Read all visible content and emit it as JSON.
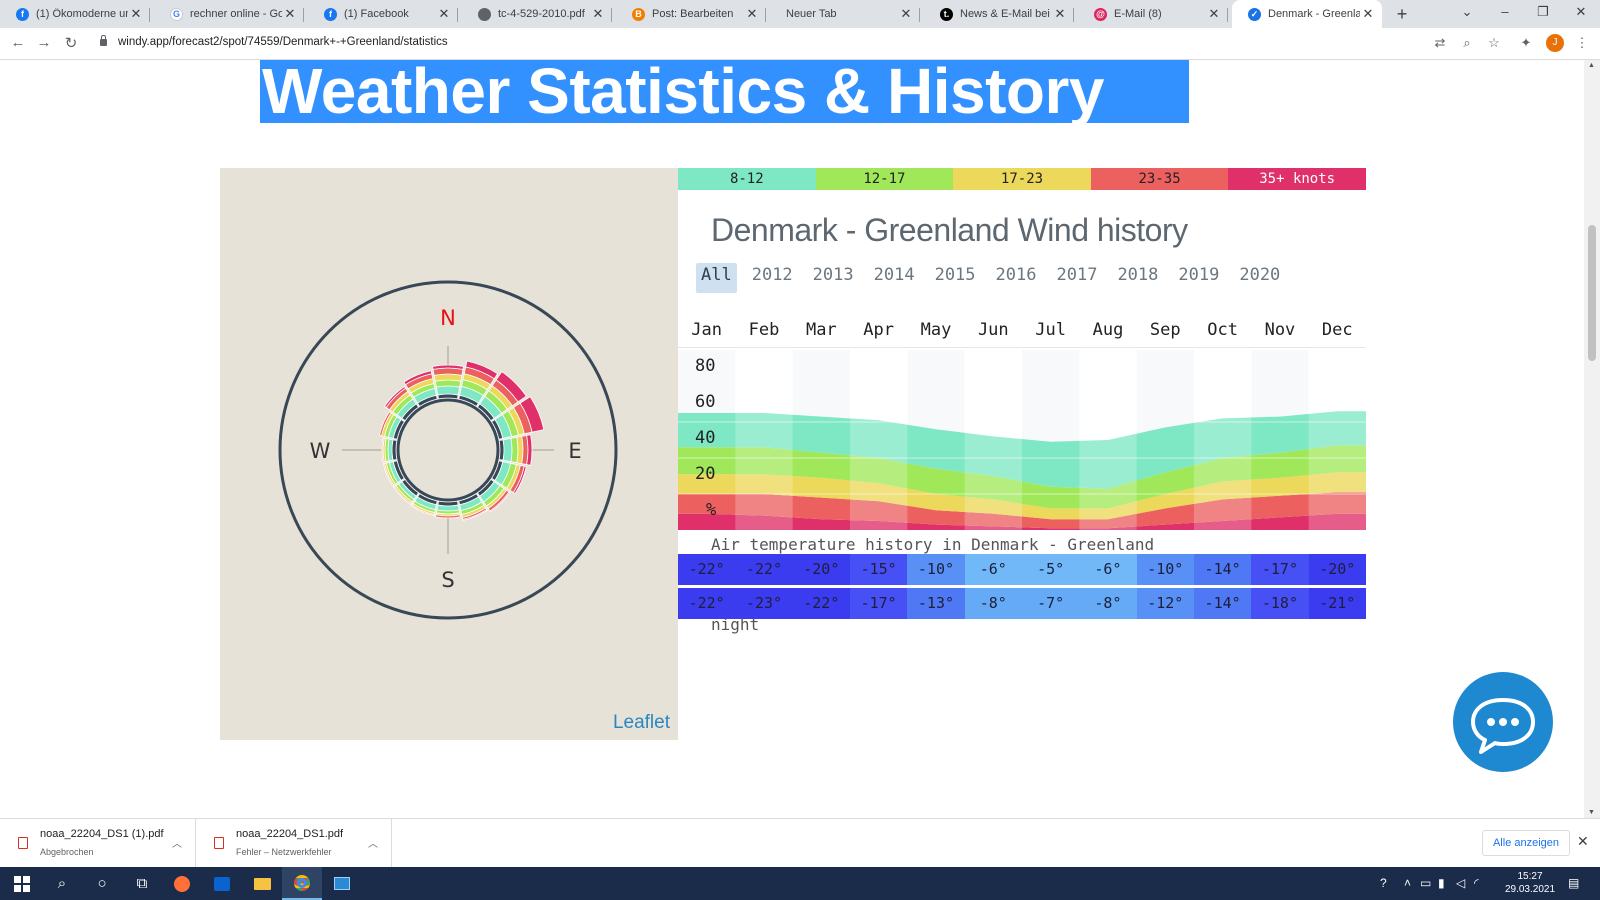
{
  "browser": {
    "tabs": [
      {
        "title": "(1) Ökomoderne und E",
        "favicon": "facebook-icon",
        "color": "#1877f2",
        "glyph": "f"
      },
      {
        "title": "rechner online - Goog",
        "favicon": "google-icon",
        "color": "#ffffff",
        "glyph": "G"
      },
      {
        "title": "(1) Facebook",
        "favicon": "facebook-icon",
        "color": "#1877f2",
        "glyph": "f"
      },
      {
        "title": "tc-4-529-2010.pdf",
        "favicon": "globe-icon",
        "color": "#5f6368",
        "glyph": ""
      },
      {
        "title": "Post: Bearbeiten",
        "favicon": "blogger-icon",
        "color": "#f57d00",
        "glyph": "B"
      },
      {
        "title": "Neuer Tab",
        "favicon": "",
        "color": "",
        "glyph": ""
      },
      {
        "title": "News & E-Mail bei t-o",
        "favicon": "t-online-icon",
        "color": "#000000",
        "glyph": "t."
      },
      {
        "title": "E-Mail (8)",
        "favicon": "at-icon",
        "color": "#e0245e",
        "glyph": "@"
      },
      {
        "title": "Denmark - Greenland",
        "favicon": "windy-icon",
        "color": "#1a73e8",
        "glyph": "✓",
        "active": true
      }
    ],
    "url": "windy.app/forecast2/spot/74559/Denmark+-+Greenland/statistics",
    "profile_initial": "J"
  },
  "page": {
    "hero_title": "Weather Statistics & History",
    "map_attribution": "Leaflet",
    "compass": {
      "n": "N",
      "e": "E",
      "s": "S",
      "w": "W"
    },
    "wind_legend": [
      {
        "label": "8-12",
        "color": "#7ee8c4"
      },
      {
        "label": "12-17",
        "color": "#a0e85a"
      },
      {
        "label": "17-23",
        "color": "#ecd85a"
      },
      {
        "label": "23-35",
        "color": "#ec6060"
      },
      {
        "label": "35+ knots",
        "color": "#e0306a"
      }
    ],
    "wind_title": "Denmark - Greenland Wind history",
    "years": [
      "All",
      "2012",
      "2013",
      "2014",
      "2015",
      "2016",
      "2017",
      "2018",
      "2019",
      "2020"
    ],
    "selected_year": "All",
    "months": [
      "Jan",
      "Feb",
      "Mar",
      "Apr",
      "May",
      "Jun",
      "Jul",
      "Aug",
      "Sep",
      "Oct",
      "Nov",
      "Dec"
    ],
    "temp_title": "Air temperature history in Denmark - Greenland",
    "night_label": "night"
  },
  "chart_data": {
    "type": "area",
    "title": "",
    "categories": [
      "Jan",
      "Feb",
      "Mar",
      "Apr",
      "May",
      "Jun",
      "Jul",
      "Aug",
      "Sep",
      "Oct",
      "Nov",
      "Dec"
    ],
    "ylabel": "%",
    "yticks": [
      "80",
      "60",
      "40",
      "20"
    ],
    "ylim": [
      0,
      80
    ],
    "series": [
      {
        "name": "35+ knots",
        "values": [
          9,
          8,
          6,
          5,
          3,
          2,
          1,
          1,
          3,
          5,
          7,
          9
        ]
      },
      {
        "name": "23-35",
        "values": [
          11,
          12,
          12,
          11,
          8,
          7,
          5,
          5,
          9,
          12,
          12,
          12
        ]
      },
      {
        "name": "17-23",
        "values": [
          11,
          11,
          11,
          10,
          9,
          8,
          6,
          6,
          8,
          10,
          10,
          11
        ]
      },
      {
        "name": "12-17",
        "values": [
          15,
          15,
          14,
          14,
          14,
          13,
          12,
          11,
          12,
          13,
          14,
          15
        ]
      },
      {
        "name": "8-12",
        "values": [
          19,
          19,
          20,
          21,
          22,
          22,
          25,
          27,
          25,
          22,
          20,
          19
        ]
      }
    ],
    "temperature_day": [
      "-22°",
      "-22°",
      "-20°",
      "-15°",
      "-10°",
      "-6°",
      "-5°",
      "-6°",
      "-10°",
      "-14°",
      "-17°",
      "-20°"
    ],
    "temperature_night": [
      "-22°",
      "-23°",
      "-22°",
      "-17°",
      "-13°",
      "-8°",
      "-7°",
      "-8°",
      "-12°",
      "-14°",
      "-18°",
      "-21°"
    ],
    "grid": true
  },
  "downloads": [
    {
      "name": "noaa_22204_DS1 (1).pdf",
      "status": "Abgebrochen"
    },
    {
      "name": "noaa_22204_DS1.pdf",
      "status": "Fehler – Netzwerkfehler"
    }
  ],
  "download_bar": {
    "show_all": "Alle anzeigen"
  },
  "taskbar": {
    "time": "15:27",
    "date": "29.03.2021"
  }
}
